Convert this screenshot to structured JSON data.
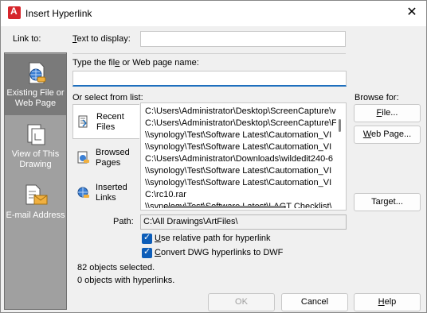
{
  "window": {
    "title": "Insert Hyperlink",
    "app_icon_letter": "A"
  },
  "sidebar": {
    "heading": "Link to:",
    "items": [
      {
        "label_line1": "Existing File or",
        "label_line2": "Web Page",
        "icon": "globe-document-icon",
        "active": true
      },
      {
        "label_line1": "View of This",
        "label_line2": "Drawing",
        "icon": "drawing-view-icon",
        "active": false
      },
      {
        "label_line1": "E-mail Address",
        "label_line2": "",
        "icon": "email-icon",
        "active": false
      }
    ]
  },
  "fields": {
    "text_to_display_label": "Text to display:",
    "text_to_display_value": "",
    "file_name_label": "Type the file or Web page name:",
    "file_name_value": "",
    "select_from_list_label": "Or select from list:",
    "path_label": "Path:",
    "path_value": "C:\\All Drawings\\ArtFiles\\"
  },
  "list_tabs": [
    {
      "line1": "Recent",
      "line2": "Files",
      "icon": "recent-files-icon",
      "active": true
    },
    {
      "line1": "Browsed",
      "line2": "Pages",
      "icon": "browsed-pages-icon",
      "active": false
    },
    {
      "line1": "Inserted",
      "line2": "Links",
      "icon": "inserted-links-icon",
      "active": false
    }
  ],
  "list_items": [
    "C:\\Users\\Administrator\\Desktop\\ScreenCapture\\v",
    "C:\\Users\\Administrator\\Desktop\\ScreenCapture\\F",
    "\\\\synology\\Test\\Software Latest\\Cautomation_VI",
    "\\\\synology\\Test\\Software Latest\\Cautomation_VI",
    "C:\\Users\\Administrator\\Downloads\\wildedit240-6",
    "\\\\synology\\Test\\Software Latest\\Cautomation_VI",
    "\\\\synology\\Test\\Software Latest\\Cautomation_VI",
    "C:\\rc10.rar",
    "\\\\synology\\Test\\Software Latest\\LAGT Checklist\\"
  ],
  "browse": {
    "label": "Browse for:",
    "file_button": "File...",
    "web_page_button": "Web Page...",
    "target_button": "Target..."
  },
  "options": {
    "relative_path": {
      "label": "Use relative path for hyperlink",
      "checked": true
    },
    "convert_dwg": {
      "label": "Convert DWG hyperlinks to DWF",
      "checked": true
    }
  },
  "status": {
    "objects_selected": "82 objects selected.",
    "objects_with_links": "0 objects with hyperlinks."
  },
  "buttons": {
    "ok": "OK",
    "cancel": "Cancel",
    "help": "Help"
  },
  "colors": {
    "accent": "#1e6fbe",
    "checkbox": "#0d5db8",
    "app_icon": "#d6252b",
    "sidebar_bg": "#a0a0a0"
  }
}
